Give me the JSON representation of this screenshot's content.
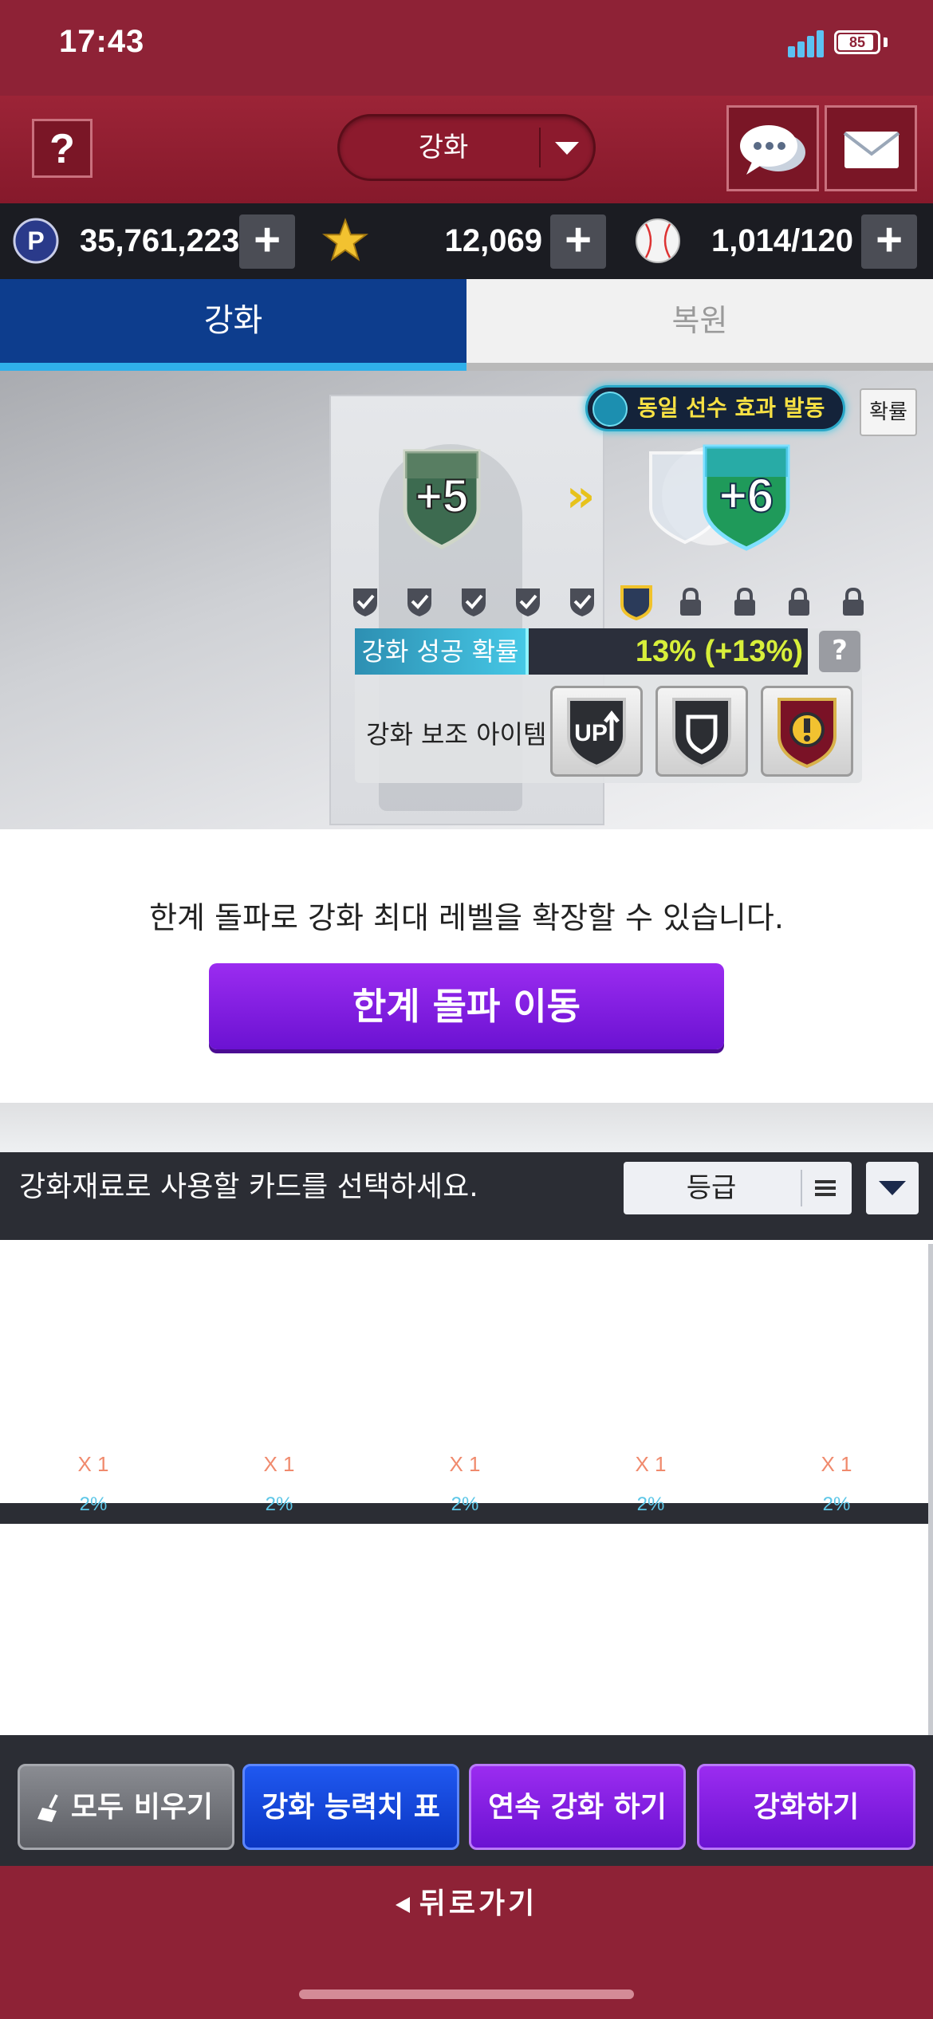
{
  "status_bar": {
    "time": "17:43",
    "battery": "85"
  },
  "header": {
    "help_label": "?",
    "menu_title": "강화"
  },
  "currencies": [
    {
      "icon": "p-coin-icon",
      "value": "35,761,223"
    },
    {
      "icon": "star-icon",
      "value": "12,069"
    },
    {
      "icon": "baseball-icon",
      "value": "1,014/120"
    }
  ],
  "plus_label": "+",
  "tabs": [
    {
      "label": "강화",
      "active": true
    },
    {
      "label": "복원",
      "active": false
    }
  ],
  "enhance": {
    "effect_label": "동일 선수 효과 발동",
    "probability_button": "확률",
    "current_level": "+5",
    "next_level": "+6",
    "level_slots": [
      "done",
      "done",
      "done",
      "done",
      "done",
      "current",
      "locked",
      "locked",
      "locked",
      "locked"
    ],
    "success_label": "강화 성공 확률",
    "success_value": "13% (+13%)",
    "help": "?",
    "aux_label": "강화 보조 아이템",
    "aux_items": [
      "up-arrow-shield-icon",
      "shield-icon",
      "warning-gear-icon"
    ]
  },
  "limit_break": {
    "message": "한계 돌파로 강화 최대 레벨을 확장할 수 있습니다.",
    "button": "한계 돌파 이동"
  },
  "material": {
    "instruction": "강화재료로 사용할 카드를 선택하세요.",
    "sort_label": "등급",
    "slots": [
      {
        "qty": "X 1",
        "pct": "2%"
      },
      {
        "qty": "X 1",
        "pct": "2%"
      },
      {
        "qty": "X 1",
        "pct": "2%"
      },
      {
        "qty": "X 1",
        "pct": "2%"
      },
      {
        "qty": "X 1",
        "pct": "2%"
      }
    ]
  },
  "actions": {
    "clear_all": "모두 비우기",
    "stats_table": "강화 능력치 표",
    "continuous": "연속 강화 하기",
    "enhance": "강화하기"
  },
  "back_label": "뒤로가기",
  "colors": {
    "brand_red": "#8e2236",
    "tab_blue": "#0d3d8d",
    "purple": "#7b1be0",
    "success_yellow": "#d8ef3a"
  }
}
